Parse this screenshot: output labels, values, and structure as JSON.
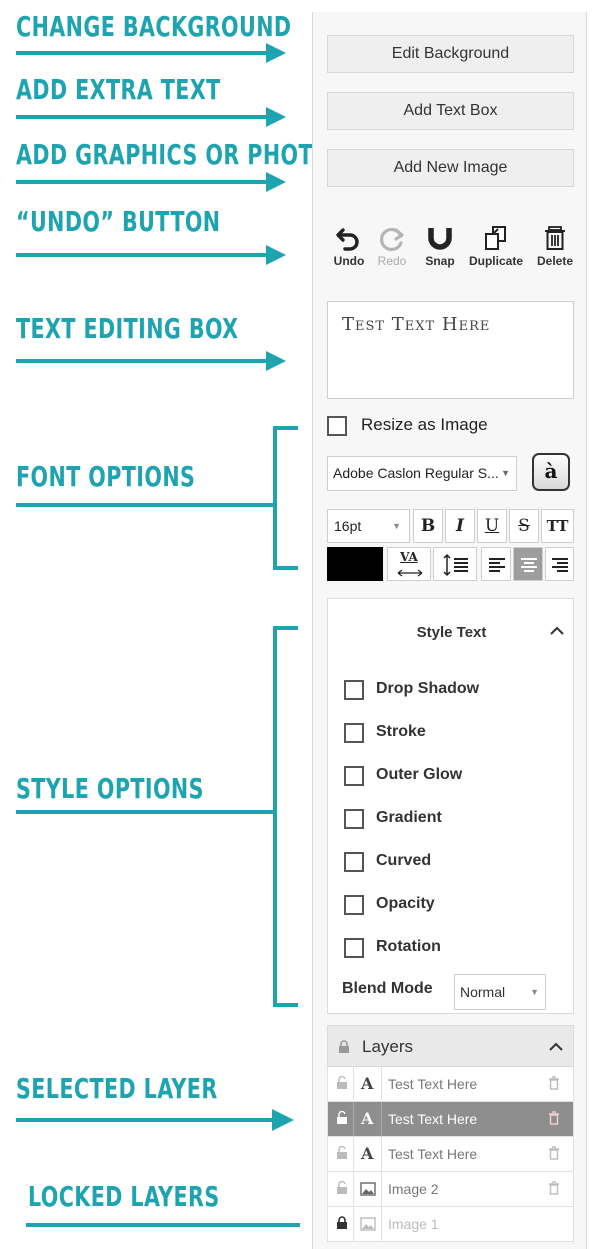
{
  "annotations": [
    "CHANGE BACKGROUND",
    "ADD EXTRA TEXT",
    "ADD GRAPHICS OR PHOTO",
    "“UNDO” BUTTON",
    "TEXT EDITING BOX",
    "FONT OPTIONS",
    "STYLE OPTIONS",
    "SELECTED LAYER",
    "LOCKED LAYERS"
  ],
  "accent_color": "#1ea3b0",
  "panel": {
    "edit_background": "Edit Background",
    "add_text_box": "Add Text Box",
    "add_new_image": "Add New Image",
    "tools": [
      {
        "label": "Undo",
        "icon": "undo-icon",
        "enabled": true
      },
      {
        "label": "Redo",
        "icon": "redo-icon",
        "enabled": false
      },
      {
        "label": "Snap",
        "icon": "magnet-icon",
        "enabled": true
      },
      {
        "label": "Duplicate",
        "icon": "duplicate-icon",
        "enabled": true
      },
      {
        "label": "Delete",
        "icon": "trash-icon",
        "enabled": true
      }
    ],
    "text_value": "Test Text Here",
    "resize_as_image": "Resize as Image",
    "font_family": "Adobe Caslon Regular S...",
    "accent_char": "à",
    "font_size": "16pt",
    "format_buttons": [
      "B",
      "I",
      "U",
      "S",
      "TT"
    ],
    "spacing_glyph": "VA",
    "text_color": "#000000",
    "style_text": {
      "title": "Style Text",
      "options": [
        "Drop Shadow",
        "Stroke",
        "Outer Glow",
        "Gradient",
        "Curved",
        "Opacity",
        "Rotation"
      ],
      "blend_label": "Blend Mode",
      "blend_value": "Normal"
    },
    "layers": {
      "title": "Layers",
      "items": [
        {
          "name": "Test Text Here",
          "type": "text",
          "state": "normal"
        },
        {
          "name": "Test Text Here",
          "type": "text",
          "state": "selected"
        },
        {
          "name": "Test Text Here",
          "type": "text",
          "state": "normal"
        },
        {
          "name": "Image 2",
          "type": "image",
          "state": "normal"
        },
        {
          "name": "Image 1",
          "type": "image",
          "state": "locked"
        }
      ]
    }
  }
}
